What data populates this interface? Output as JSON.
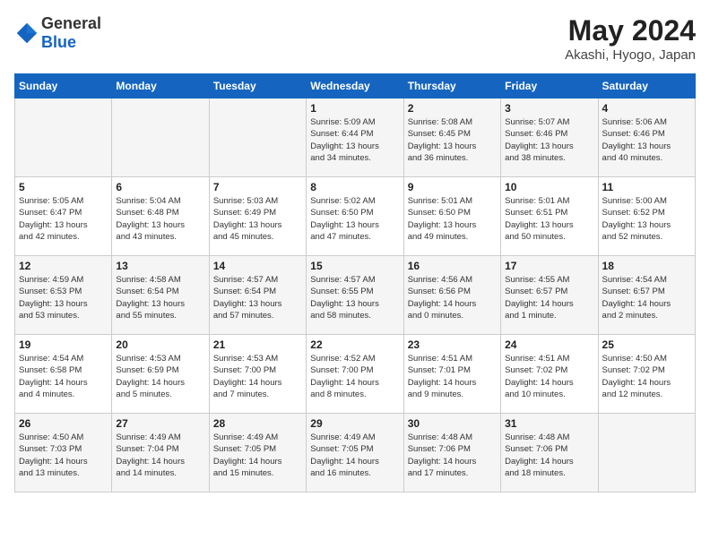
{
  "logo": {
    "text_general": "General",
    "text_blue": "Blue"
  },
  "header": {
    "month": "May 2024",
    "location": "Akashi, Hyogo, Japan"
  },
  "weekdays": [
    "Sunday",
    "Monday",
    "Tuesday",
    "Wednesday",
    "Thursday",
    "Friday",
    "Saturday"
  ],
  "weeks": [
    [
      {
        "day": "",
        "info": ""
      },
      {
        "day": "",
        "info": ""
      },
      {
        "day": "",
        "info": ""
      },
      {
        "day": "1",
        "info": "Sunrise: 5:09 AM\nSunset: 6:44 PM\nDaylight: 13 hours\nand 34 minutes."
      },
      {
        "day": "2",
        "info": "Sunrise: 5:08 AM\nSunset: 6:45 PM\nDaylight: 13 hours\nand 36 minutes."
      },
      {
        "day": "3",
        "info": "Sunrise: 5:07 AM\nSunset: 6:46 PM\nDaylight: 13 hours\nand 38 minutes."
      },
      {
        "day": "4",
        "info": "Sunrise: 5:06 AM\nSunset: 6:46 PM\nDaylight: 13 hours\nand 40 minutes."
      }
    ],
    [
      {
        "day": "5",
        "info": "Sunrise: 5:05 AM\nSunset: 6:47 PM\nDaylight: 13 hours\nand 42 minutes."
      },
      {
        "day": "6",
        "info": "Sunrise: 5:04 AM\nSunset: 6:48 PM\nDaylight: 13 hours\nand 43 minutes."
      },
      {
        "day": "7",
        "info": "Sunrise: 5:03 AM\nSunset: 6:49 PM\nDaylight: 13 hours\nand 45 minutes."
      },
      {
        "day": "8",
        "info": "Sunrise: 5:02 AM\nSunset: 6:50 PM\nDaylight: 13 hours\nand 47 minutes."
      },
      {
        "day": "9",
        "info": "Sunrise: 5:01 AM\nSunset: 6:50 PM\nDaylight: 13 hours\nand 49 minutes."
      },
      {
        "day": "10",
        "info": "Sunrise: 5:01 AM\nSunset: 6:51 PM\nDaylight: 13 hours\nand 50 minutes."
      },
      {
        "day": "11",
        "info": "Sunrise: 5:00 AM\nSunset: 6:52 PM\nDaylight: 13 hours\nand 52 minutes."
      }
    ],
    [
      {
        "day": "12",
        "info": "Sunrise: 4:59 AM\nSunset: 6:53 PM\nDaylight: 13 hours\nand 53 minutes."
      },
      {
        "day": "13",
        "info": "Sunrise: 4:58 AM\nSunset: 6:54 PM\nDaylight: 13 hours\nand 55 minutes."
      },
      {
        "day": "14",
        "info": "Sunrise: 4:57 AM\nSunset: 6:54 PM\nDaylight: 13 hours\nand 57 minutes."
      },
      {
        "day": "15",
        "info": "Sunrise: 4:57 AM\nSunset: 6:55 PM\nDaylight: 13 hours\nand 58 minutes."
      },
      {
        "day": "16",
        "info": "Sunrise: 4:56 AM\nSunset: 6:56 PM\nDaylight: 14 hours\nand 0 minutes."
      },
      {
        "day": "17",
        "info": "Sunrise: 4:55 AM\nSunset: 6:57 PM\nDaylight: 14 hours\nand 1 minute."
      },
      {
        "day": "18",
        "info": "Sunrise: 4:54 AM\nSunset: 6:57 PM\nDaylight: 14 hours\nand 2 minutes."
      }
    ],
    [
      {
        "day": "19",
        "info": "Sunrise: 4:54 AM\nSunset: 6:58 PM\nDaylight: 14 hours\nand 4 minutes."
      },
      {
        "day": "20",
        "info": "Sunrise: 4:53 AM\nSunset: 6:59 PM\nDaylight: 14 hours\nand 5 minutes."
      },
      {
        "day": "21",
        "info": "Sunrise: 4:53 AM\nSunset: 7:00 PM\nDaylight: 14 hours\nand 7 minutes."
      },
      {
        "day": "22",
        "info": "Sunrise: 4:52 AM\nSunset: 7:00 PM\nDaylight: 14 hours\nand 8 minutes."
      },
      {
        "day": "23",
        "info": "Sunrise: 4:51 AM\nSunset: 7:01 PM\nDaylight: 14 hours\nand 9 minutes."
      },
      {
        "day": "24",
        "info": "Sunrise: 4:51 AM\nSunset: 7:02 PM\nDaylight: 14 hours\nand 10 minutes."
      },
      {
        "day": "25",
        "info": "Sunrise: 4:50 AM\nSunset: 7:02 PM\nDaylight: 14 hours\nand 12 minutes."
      }
    ],
    [
      {
        "day": "26",
        "info": "Sunrise: 4:50 AM\nSunset: 7:03 PM\nDaylight: 14 hours\nand 13 minutes."
      },
      {
        "day": "27",
        "info": "Sunrise: 4:49 AM\nSunset: 7:04 PM\nDaylight: 14 hours\nand 14 minutes."
      },
      {
        "day": "28",
        "info": "Sunrise: 4:49 AM\nSunset: 7:05 PM\nDaylight: 14 hours\nand 15 minutes."
      },
      {
        "day": "29",
        "info": "Sunrise: 4:49 AM\nSunset: 7:05 PM\nDaylight: 14 hours\nand 16 minutes."
      },
      {
        "day": "30",
        "info": "Sunrise: 4:48 AM\nSunset: 7:06 PM\nDaylight: 14 hours\nand 17 minutes."
      },
      {
        "day": "31",
        "info": "Sunrise: 4:48 AM\nSunset: 7:06 PM\nDaylight: 14 hours\nand 18 minutes."
      },
      {
        "day": "",
        "info": ""
      }
    ]
  ]
}
